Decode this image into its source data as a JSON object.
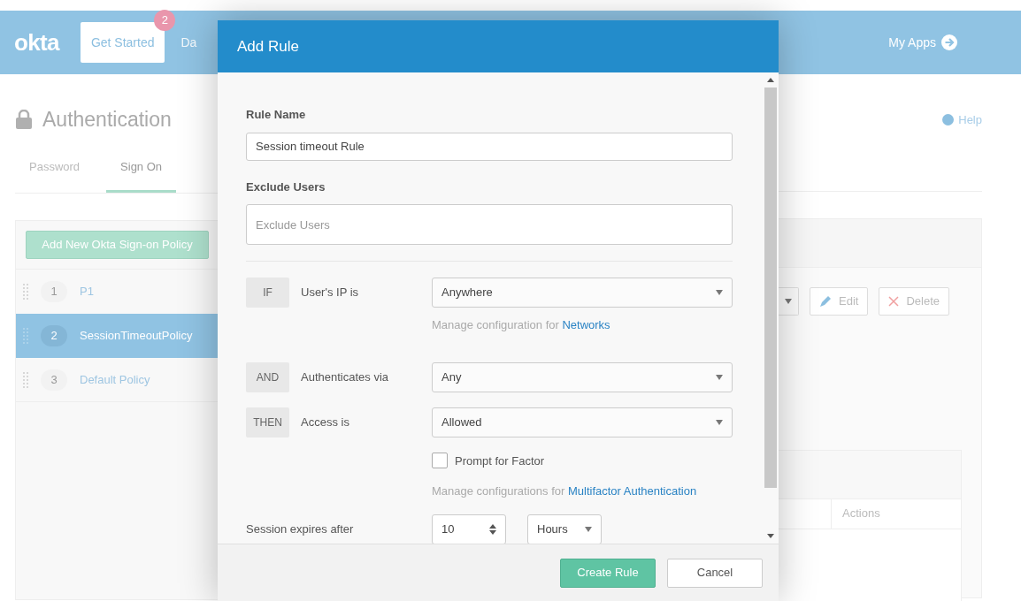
{
  "header": {
    "logo": "okta",
    "nav": [
      {
        "label": "Get Started",
        "badge": "2",
        "selected": true
      },
      {
        "label": "Da",
        "selected": false
      }
    ],
    "my_apps": "My Apps"
  },
  "page": {
    "title": "Authentication",
    "help": "Help",
    "tabs": [
      {
        "label": "Password",
        "selected": false
      },
      {
        "label": "Sign On",
        "selected": true
      }
    ]
  },
  "policies": {
    "add_button": "Add New Okta Sign-on Policy",
    "items": [
      {
        "number": "1",
        "name": "P1",
        "selected": false
      },
      {
        "number": "2",
        "name": "SessionTimeoutPolicy",
        "selected": true
      },
      {
        "number": "3",
        "name": "Default Policy",
        "selected": false
      }
    ]
  },
  "policy_actions": {
    "buttons": [
      {
        "kind": "edit",
        "label": "Edit"
      },
      {
        "kind": "delete",
        "label": "Delete"
      }
    ],
    "table_columns": [
      "Actions"
    ]
  },
  "modal": {
    "title": "Add Rule",
    "rule_name": {
      "label": "Rule Name",
      "value": "Session timeout Rule"
    },
    "exclude_users": {
      "label": "Exclude Users",
      "placeholder": "Exclude Users"
    },
    "conditions": [
      {
        "keyword": "IF",
        "label": "User's IP is",
        "value": "Anywhere",
        "help_text": "Manage configuration for ",
        "help_link": "Networks"
      },
      {
        "keyword": "AND",
        "label": "Authenticates via",
        "value": "Any"
      },
      {
        "keyword": "THEN",
        "label": "Access is",
        "value": "Allowed"
      }
    ],
    "prompt_for_factor": {
      "label": "Prompt for Factor",
      "checked": false,
      "help_text": "Manage configurations for ",
      "help_link": "Multifactor Authentication"
    },
    "session": {
      "label": "Session expires after",
      "value": "10",
      "unit": "Hours"
    },
    "buttons": [
      {
        "kind": "primary",
        "label": "Create Rule"
      },
      {
        "kind": "secondary",
        "label": "Cancel"
      }
    ]
  }
}
